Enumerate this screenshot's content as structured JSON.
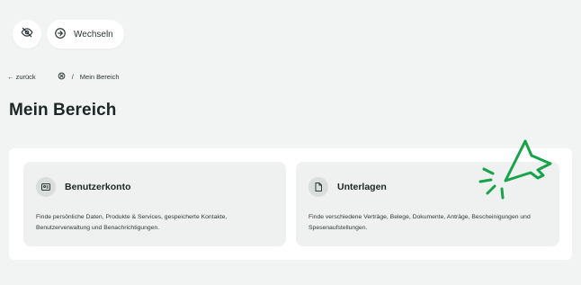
{
  "topbar": {
    "visibility_icon": "eye-off-icon",
    "switch_icon": "arrow-right-circle-icon",
    "switch_label": "Wechseln"
  },
  "breadcrumb": {
    "back_label": "← zurück",
    "home_icon": "home-badge-icon",
    "separator": "/",
    "current": "Mein Bereich"
  },
  "page": {
    "title": "Mein Bereich"
  },
  "cards": [
    {
      "icon": "id-card-icon",
      "title": "Benutzerkonto",
      "description": "Finde persönliche Daten, Produkte & Services, gespeicherte Kontakte, Benutzerverwaltung und Benachrichtigungen."
    },
    {
      "icon": "document-icon",
      "title": "Unterlagen",
      "description": "Finde verschiedene Verträge, Belege, Dokumente, Anträge, Bescheinigungen und Spesenaufstellungen."
    }
  ],
  "colors": {
    "accent": "#16a34a",
    "background": "#f2f4f3",
    "card": "#eef1f0",
    "panel": "#ffffff"
  },
  "overlay": {
    "icon": "click-cursor-icon"
  }
}
